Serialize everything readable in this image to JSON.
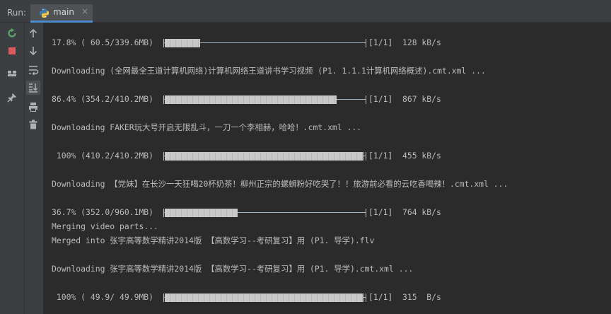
{
  "run_panel": {
    "run_label": "Run:",
    "tab": {
      "label": "main",
      "icon": "python-icon",
      "close": "×"
    }
  },
  "toolbar": {
    "left_column": [
      {
        "icon": "rerun-icon",
        "active": false
      },
      {
        "icon": "stop-icon",
        "active": false
      },
      {
        "icon": "layout-icon",
        "active": false
      },
      {
        "icon": "pin-icon",
        "active": false
      }
    ],
    "right_column": [
      {
        "icon": "arrow-up-icon",
        "active": false
      },
      {
        "icon": "arrow-down-icon",
        "active": false
      },
      {
        "icon": "soft-wrap-icon",
        "active": false
      },
      {
        "icon": "scroll-to-end-icon",
        "active": true
      },
      {
        "icon": "print-icon",
        "active": false
      },
      {
        "icon": "trash-icon",
        "active": false
      }
    ]
  },
  "console": {
    "lines": [
      {
        "kind": "progress",
        "prefix": "17.8% ( 60.5/339.6MB) ",
        "progress": 0.178,
        "suffix": "[1/1]  128 kB/s"
      },
      {
        "kind": "text",
        "text": "Downloading (全网最全王道计算机网络)计算机网络王道讲书学习视频 (P1. 1.1.1计算机网络概述).cmt.xml ..."
      },
      {
        "kind": "progress",
        "prefix": "86.4% (354.2/410.2MB) ",
        "progress": 0.864,
        "suffix": "[1/1]  867 kB/s"
      },
      {
        "kind": "text",
        "text": "Downloading FAKER玩大号开启无限乱斗，一刀一个李相赫，哈哈！.cmt.xml ..."
      },
      {
        "kind": "progress",
        "prefix": " 100% (410.2/410.2MB) ",
        "progress": 1.0,
        "suffix": "[1/1]  455 kB/s"
      },
      {
        "kind": "text",
        "text": "Downloading 【党妹】在长沙一天狂喝20杯奶茶！柳州正宗的螺蛳粉好吃哭了！！旅游前必看的云吃香喝辣！.cmt.xml ..."
      },
      {
        "kind": "progress",
        "prefix": "36.7% (352.0/960.1MB) ",
        "progress": 0.367,
        "suffix": "[1/1]  764 kB/s"
      },
      {
        "kind": "text",
        "text": "Merging video parts..."
      },
      {
        "kind": "text",
        "text": "Merged into 张宇高等数学精讲2014版 【高数学习--考研复习】用 (P1. 导学).flv"
      },
      {
        "kind": "text",
        "text": "Downloading 张宇高等数学精讲2014版 【高数学习--考研复习】用 (P1. 导学).cmt.xml ..."
      },
      {
        "kind": "progress",
        "prefix": " 100% ( 49.9/ 49.9MB) ",
        "progress": 1.0,
        "suffix": "[1/1]  315  B/s"
      }
    ]
  },
  "colors": {
    "background": "#2b2b2b",
    "panel": "#3c3f41",
    "text": "#bbbbbb",
    "accent": "#4a88c7",
    "rerun": "#59a869",
    "stop": "#db5c5c"
  }
}
